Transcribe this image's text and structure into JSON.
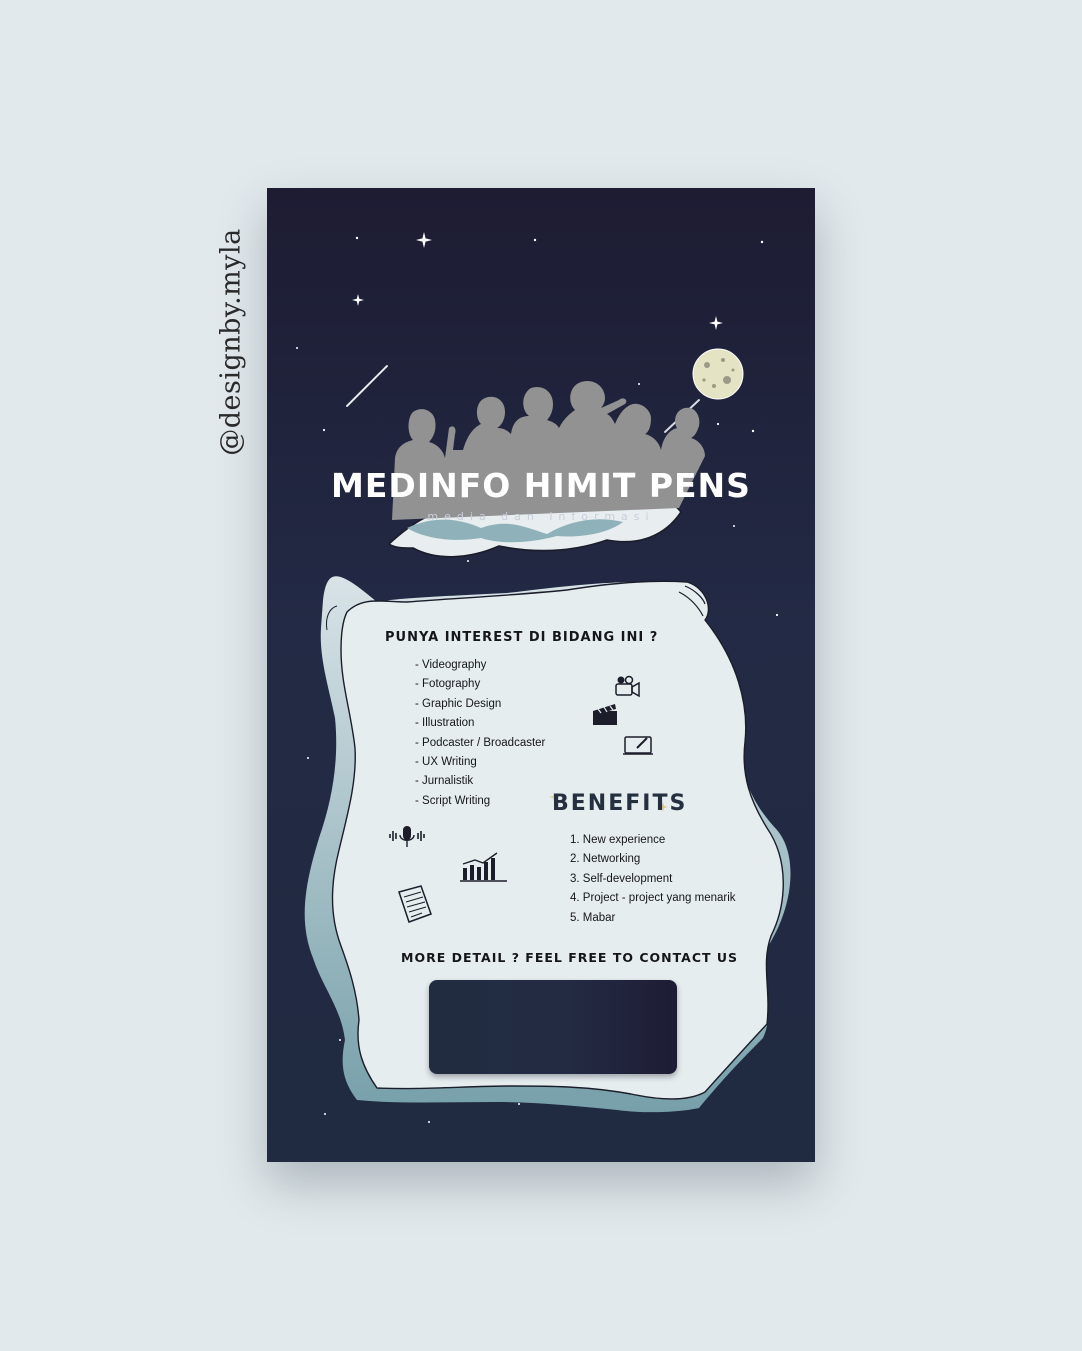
{
  "credit": "@designby.myla",
  "poster": {
    "title": "MEDINFO HIMIT PENS",
    "subtitle": "media dan informasi",
    "interest_heading": "PUNYA INTEREST DI BIDANG INI ?",
    "interests": [
      "- Videography",
      "- Fotography",
      "- Graphic Design",
      "- Illustration",
      "- Podcaster / Broadcaster",
      "- UX Writing",
      "- Jurnalistik",
      "- Script Writing"
    ],
    "benefits_heading": "BENEFITS",
    "benefits": [
      "1. New experience",
      "2. Networking",
      "3. Self-development",
      "4. Project - project yang menarik",
      "5. Mabar"
    ],
    "contact_heading": "MORE DETAIL ? FEEL FREE TO CONTACT US"
  },
  "colors": {
    "page_background": "#e1e9ec",
    "poster_background": "#202a40",
    "panel": "#e5ecee",
    "panel_accent": "#7fa3ae",
    "silhouette": "#929292",
    "moon": "#e4e3c4",
    "contact_box": "#212c41"
  },
  "icons": [
    "moon-icon",
    "shooting-star-icon",
    "video-camera-icon",
    "clapperboard-icon",
    "tablet-pen-icon",
    "microphone-icon",
    "growth-chart-icon",
    "document-icon"
  ]
}
